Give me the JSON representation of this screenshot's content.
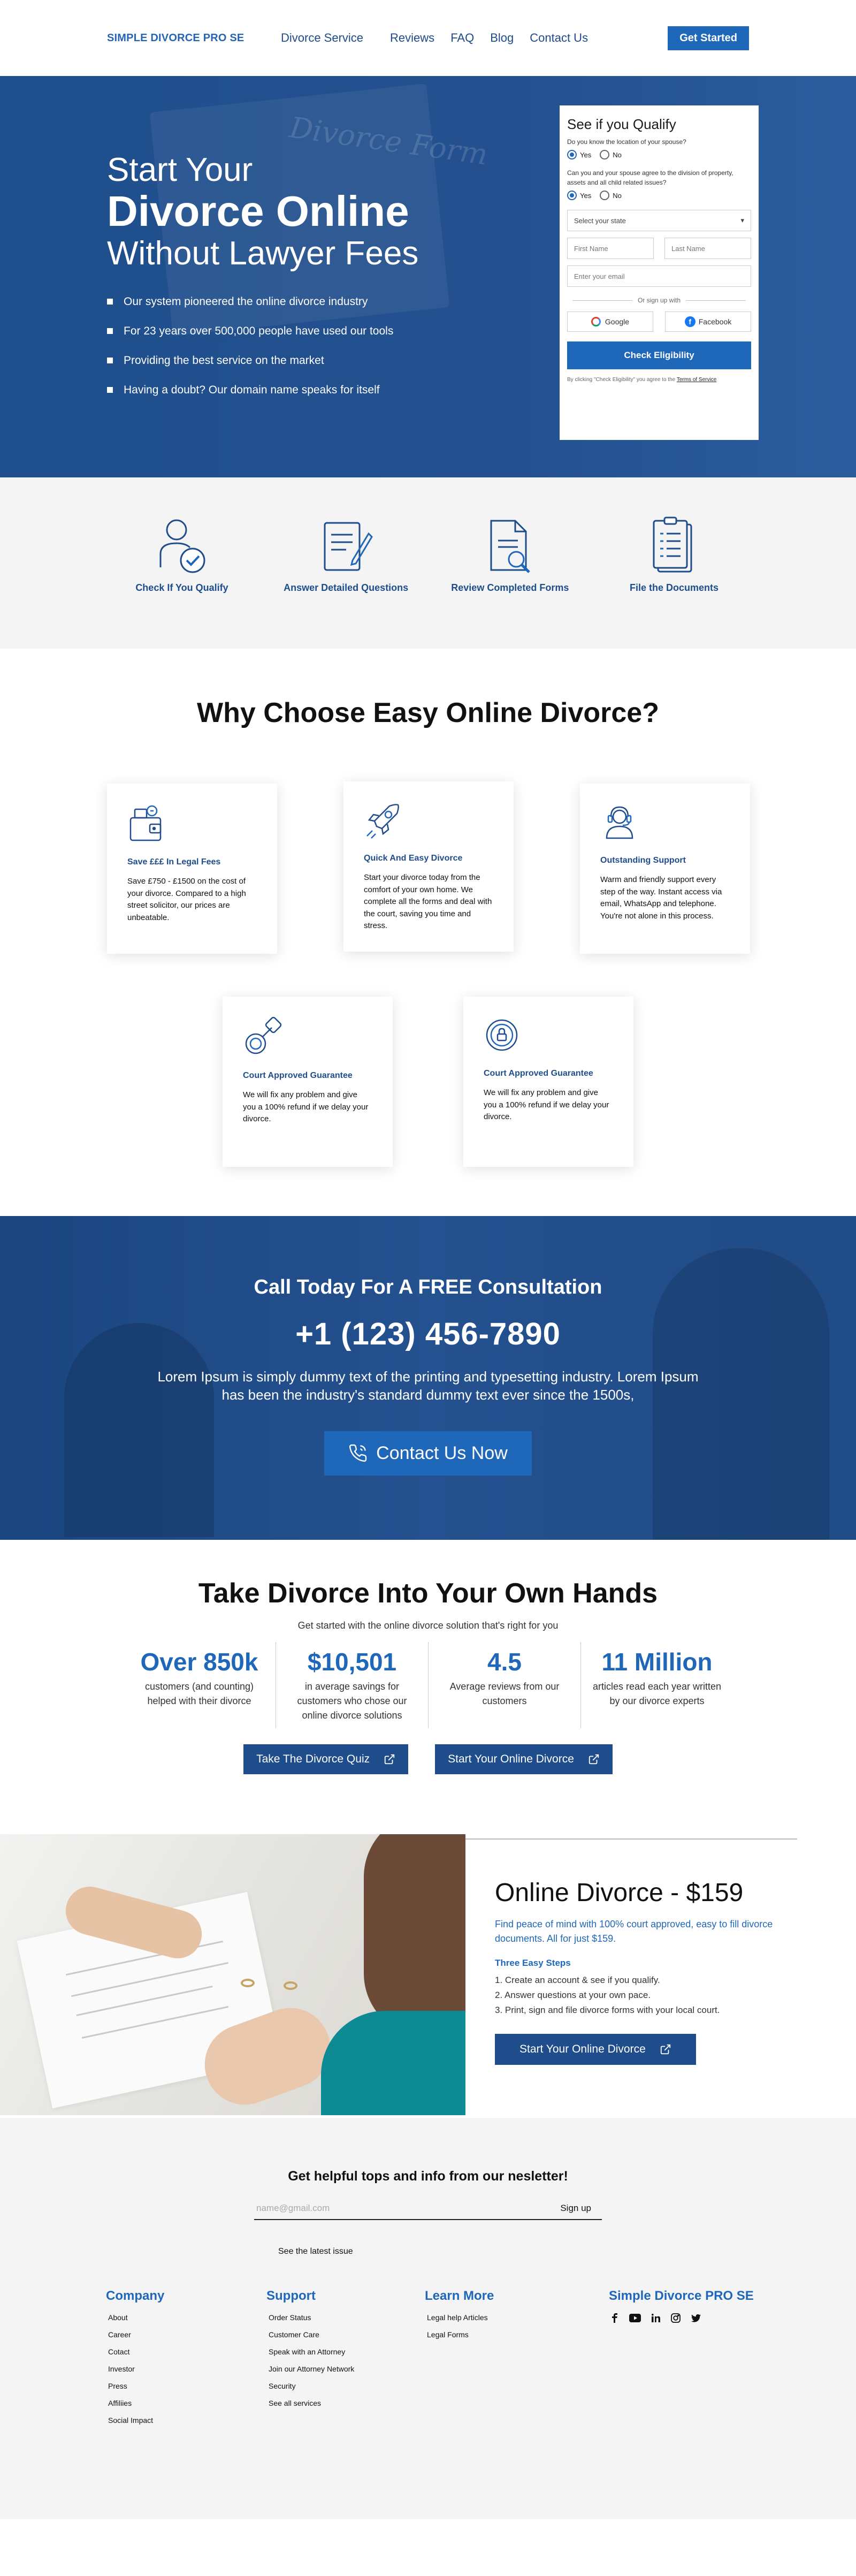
{
  "header": {
    "logo": "SIMPLE DIVORCE PRO SE",
    "nav": [
      "Divorce Service",
      "Reviews",
      "FAQ",
      "Blog",
      "Contact Us"
    ],
    "cta": "Get Started"
  },
  "hero": {
    "bg_text": "Divorce Form",
    "line1": "Start Your",
    "line2": "Divorce Online",
    "line3": "Without Lawyer Fees",
    "bullets": [
      "Our system pioneered the online divorce industry",
      "For 23 years over 500,000 people have used our tools",
      "Providing the best service on the market",
      "Having a doubt? Our domain name speaks for itself"
    ]
  },
  "qualify": {
    "title": "See if you Qualify",
    "q1": "Do you know the location of your spouse?",
    "q2": "Can you and your spouse agree to the division of property, assets and all child related issues?",
    "yes": "Yes",
    "no": "No",
    "state_placeholder": "Select your state",
    "first_name": "First Name",
    "last_name": "Last Name",
    "email": "Enter your email",
    "or": "Or sign up with",
    "google": "Google",
    "facebook": "Facebook",
    "submit": "Check Eligibility",
    "terms_prefix": "By clicking \"Check Eligibility\" you agree to the",
    "terms_link": "Terms of Service"
  },
  "steps": [
    {
      "label": "Check If You Qualify",
      "icon": "person-check-icon"
    },
    {
      "label": "Answer Detailed Questions",
      "icon": "form-pencil-icon"
    },
    {
      "label": "Review Completed Forms",
      "icon": "document-search-icon"
    },
    {
      "label": "File the Documents",
      "icon": "clipboard-list-icon"
    }
  ],
  "why": {
    "title": "Why Choose Easy Online Divorce?",
    "cards": [
      {
        "title": "Save £££ In Legal Fees",
        "text": "Save £750 - £1500 on the cost of your divorce. Compared to a high street solicitor, our prices are unbeatable.",
        "icon": "wallet-icon"
      },
      {
        "title": "Quick And Easy Divorce",
        "text": "Start your divorce today from the comfort of your own home. We complete all the forms and deal with the court, saving you time and stress.",
        "icon": "rocket-icon"
      },
      {
        "title": "Outstanding Support",
        "text": "Warm and friendly support every step of the way. Instant access via email, WhatsApp and telephone. You're not alone in this process.",
        "icon": "support-agent-icon"
      },
      {
        "title": "Court Approved Guarantee",
        "text": "We will fix any problem and give you a 100% refund if we delay your divorce.",
        "icon": "stamp-icon"
      },
      {
        "title": "Court Approved Guarantee",
        "text": "We will fix any problem and give you a 100% refund if we delay your divorce.",
        "icon": "lock-badge-icon"
      }
    ]
  },
  "consult": {
    "title": "Call Today For A FREE Consultation",
    "phone": "+1 (123) 456-7890",
    "text": "Lorem Ipsum is simply dummy text of the printing and typesetting industry. Lorem Ipsum has been the industry's standard dummy text ever since the 1500s,",
    "button": "Contact Us Now"
  },
  "stats": {
    "title": "Take Divorce Into Your Own Hands",
    "subtitle": "Get started with the online divorce solution that's right for you",
    "items": [
      {
        "num": "Over 850k",
        "text": "customers (and counting) helped with their divorce"
      },
      {
        "num": "$10,501",
        "text": "in average savings for customers who chose our online divorce solutions"
      },
      {
        "num": "4.5",
        "text": "Average reviews from our customers"
      },
      {
        "num": "11 Million",
        "text": "articles read each year written by our divorce experts"
      }
    ],
    "btn1": "Take The Divorce Quiz",
    "btn2": "Start Your Online Divorce"
  },
  "promo": {
    "title": "Online Divorce - $159",
    "desc": "Find peace of mind with 100% court approved, easy to fill divorce documents. All for just $159.",
    "steps_title": "Three Easy Steps",
    "steps": [
      "1. Create an account & see if you qualify.",
      "2. Answer questions at your own pace.",
      "3. Print, sign and file divorce forms with your local court."
    ],
    "button": "Start Your Online Divorce"
  },
  "footer": {
    "news_title": "Get helpful tops and info from our nesletter!",
    "email_placeholder": "name@gmail.com",
    "signup": "Sign up",
    "latest": "See the latest issue",
    "cols": [
      {
        "title": "Company",
        "links": [
          "About",
          "Career",
          "Cotact",
          "Investor",
          "Press",
          "Affiliies",
          "Social Impact"
        ]
      },
      {
        "title": "Support",
        "links": [
          "Order Status",
          "Customer Care",
          "Speak with an Attorney",
          "Join our Attorney Network",
          "Security",
          "See all services"
        ]
      },
      {
        "title": "Learn More",
        "links": [
          "Legal help Articles",
          "Legal Forms"
        ]
      },
      {
        "title": "Simple Divorce PRO SE",
        "links": []
      }
    ],
    "social_icons": [
      "facebook-icon",
      "youtube-icon",
      "linkedin-icon",
      "instagram-icon",
      "twitter-icon"
    ]
  },
  "colors": {
    "primary": "#1f67b9",
    "navy": "#1f4d8c",
    "hero": "#24508f"
  }
}
